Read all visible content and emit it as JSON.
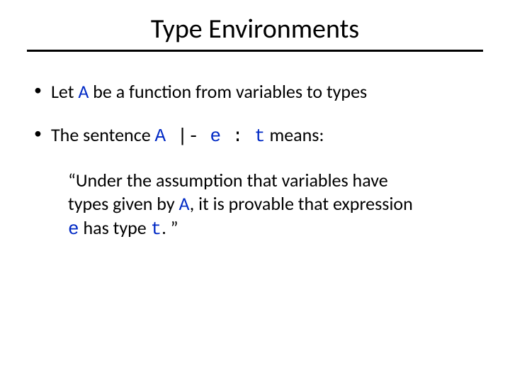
{
  "title": "Type Environments",
  "bullets": {
    "b1": {
      "p1": "Let ",
      "A": "A",
      "p2": " be a function from variables to types"
    },
    "b2": {
      "p1": "The sentence ",
      "expr_A": "A",
      "expr_turn": " |- ",
      "expr_e": "e",
      "expr_colon": " : ",
      "expr_t": "t",
      "p2": " means:"
    }
  },
  "quote": {
    "q1": "“Under the assumption that variables have types given by ",
    "A": "A",
    "q2": ", it is provable that expression ",
    "e": "e",
    "q3": " has type ",
    "t": "t",
    "q4": ". ”"
  }
}
